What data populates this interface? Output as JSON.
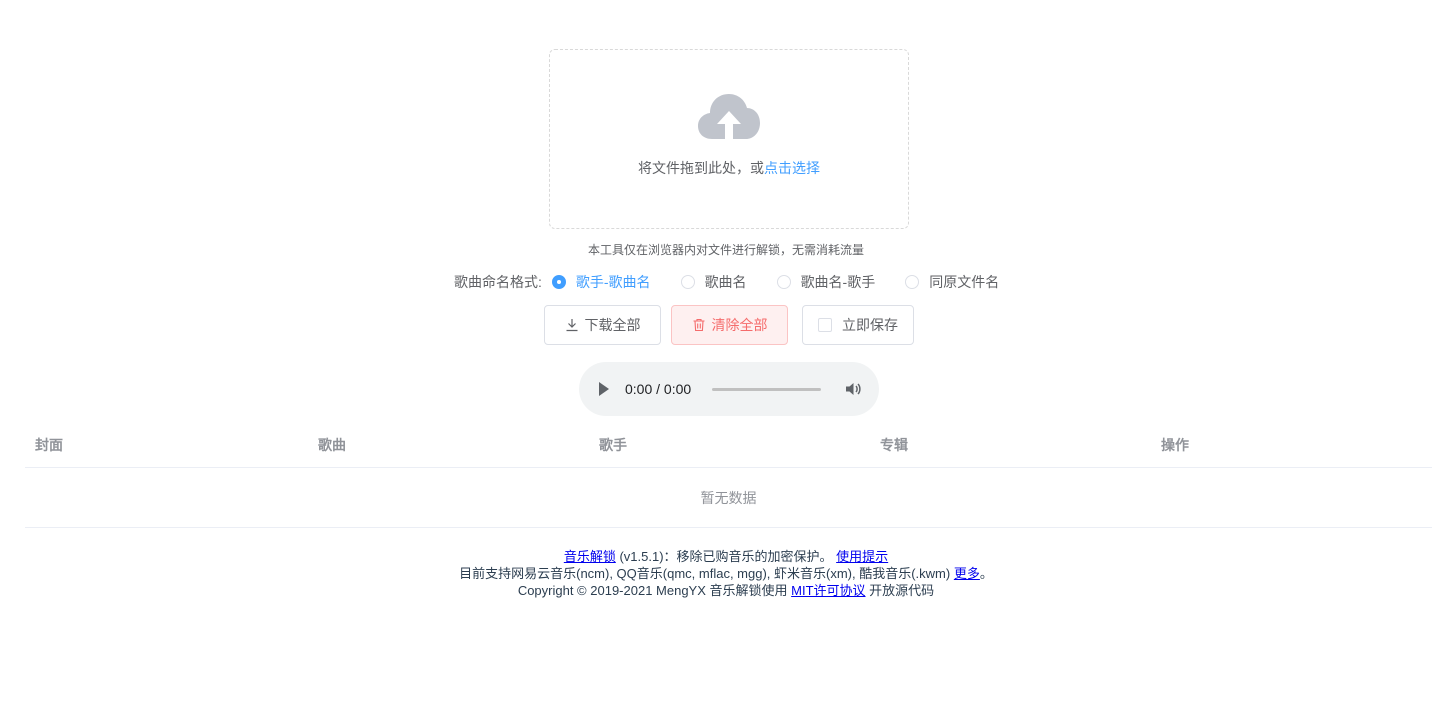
{
  "upload": {
    "text_prefix": "将文件拖到此处，或",
    "link": "点击选择",
    "icon": "cloud-upload-icon"
  },
  "tip": "本工具仅在浏览器内对文件进行解锁，无需消耗流量",
  "naming": {
    "label": "歌曲命名格式:",
    "options": [
      "歌手-歌曲名",
      "歌曲名",
      "歌曲名-歌手",
      "同原文件名"
    ],
    "selected": "歌手-歌曲名"
  },
  "buttons": {
    "download": "下载全部",
    "clear": "清除全部",
    "save": "立即保存",
    "save_checked": false
  },
  "player": {
    "time": "0:00 / 0:00"
  },
  "table": {
    "headers": [
      "封面",
      "歌曲",
      "歌手",
      "专辑",
      "操作"
    ],
    "empty_text": "暂无数据"
  },
  "footer": {
    "line1_link": "音乐解锁",
    "line1_version": "(v1.5.1)：移除已购音乐的加密保护。",
    "line1_help": "使用提示",
    "line2_text": "目前支持网易云音乐(ncm), QQ音乐(qmc, mflac, mgg), 虾米音乐(xm), 酷我音乐(.kwm)",
    "line2_more": "更多",
    "line2_end": "。",
    "line3_text": "Copyright © 2019-2021 MengYX 音乐解锁使用",
    "line3_license": "MIT许可协议",
    "line3_end": "开放源代码"
  },
  "colors": {
    "accent": "#409eff",
    "danger": "#f56c6c",
    "danger_bg": "#fef0f0",
    "link": "#0000ee"
  }
}
